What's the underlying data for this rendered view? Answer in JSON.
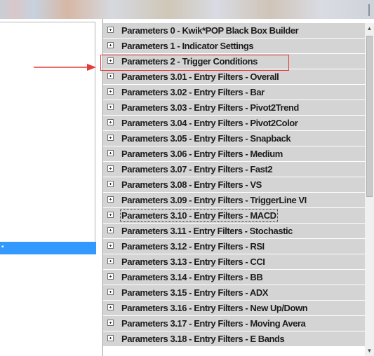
{
  "tree": {
    "items": [
      "Parameters 0 - Kwik*POP Black Box Builder",
      "Parameters 1 - Indicator Settings",
      "Parameters 2 - Trigger Conditions",
      "Parameters 3.01 - Entry Filters - Overall",
      "Parameters 3.02 - Entry Filters - Bar",
      "Parameters 3.03 - Entry Filters - Pivot2Trend",
      "Parameters 3.04 - Entry Filters - Pivot2Color",
      "Parameters 3.05 - Entry Filters - Snapback",
      "Parameters 3.06 - Entry Filters - Medium",
      "Parameters 3.07 - Entry Filters - Fast2",
      "Parameters 3.08 - Entry Filters - VS",
      "Parameters 3.09 - Entry Filters - TriggerLine VI",
      "Parameters 3.10 - Entry Filters - MACD",
      "Parameters 3.11 - Entry Filters - Stochastic",
      "Parameters 3.12 - Entry Filters - RSI",
      "Parameters 3.13 - Entry Filters - CCI",
      "Parameters 3.14 - Entry Filters - BB",
      "Parameters 3.15 - Entry Filters - ADX",
      "Parameters 3.16 - Entry Filters - New Up/Down",
      "Parameters 3.17 - Entry Filters - Moving Avera",
      "Parameters 3.18 - Entry Filters - E Bands"
    ],
    "expander_icon": "plus-box-icon",
    "focused_item": "Parameters 3.10 - Entry Filters - MACD",
    "highlighted_item": "Parameters 2 - Trigger Conditions",
    "annotation_color": "#e53a3a",
    "row_background": "#d4d4d4"
  },
  "left_panel": {
    "selection_color": "#3399ff"
  }
}
